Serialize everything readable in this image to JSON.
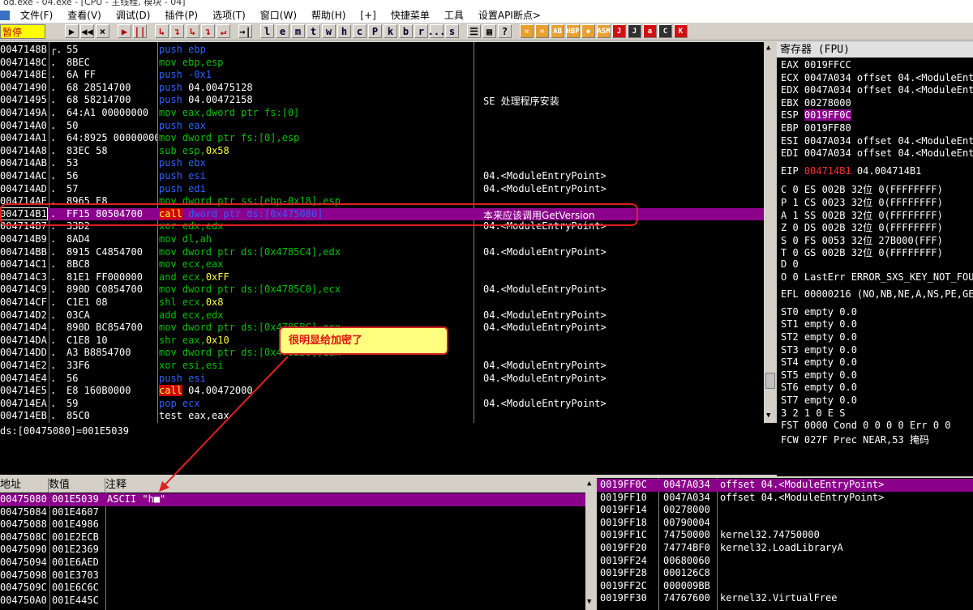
{
  "titlebar": {
    "text": "od.exe - 04.exe - [CPU - 主线程, 模块 - 04]"
  },
  "menu": [
    "文件(F)",
    "查看(V)",
    "调试(D)",
    "插件(P)",
    "选项(T)",
    "窗口(W)",
    "帮助(H)",
    "[+]",
    "快捷菜单",
    "工具",
    "设置API断点>"
  ],
  "status": "暂停",
  "toolbar": {
    "g1": [
      "▶",
      "◀◀",
      "×"
    ],
    "g2": [
      "▶",
      "||"
    ],
    "g3": [
      "↳",
      "↴",
      "↳",
      "↴",
      "↵"
    ],
    "g4": [
      "→|"
    ],
    "letters": [
      "l",
      "e",
      "m",
      "t",
      "w",
      "h",
      "c",
      "P",
      "k",
      "b",
      "r",
      "...",
      "s"
    ],
    "g5": [
      "☰",
      "▦",
      "?"
    ],
    "g6": [
      "⚒",
      "⚒",
      "AB",
      "HBP",
      "◆",
      "ASM",
      "J",
      "J",
      "a",
      "C",
      "K"
    ]
  },
  "disasm": [
    {
      "addr": "0047148B",
      "bra": "┌.",
      "hex": "55",
      "dis": [
        [
          "b",
          "push "
        ],
        [
          "b",
          "ebp"
        ]
      ],
      "cmt": ""
    },
    {
      "addr": "0047148C",
      "bra": ".",
      "hex": "8BEC",
      "dis": [
        [
          "g",
          "mov "
        ],
        [
          "g",
          "ebp,esp"
        ]
      ],
      "cmt": ""
    },
    {
      "addr": "0047148E",
      "bra": ".",
      "hex": "6A FF",
      "dis": [
        [
          "b",
          "push "
        ],
        [
          "b",
          "-0x1"
        ]
      ],
      "cmt": ""
    },
    {
      "addr": "00471490",
      "bra": ".",
      "hex": "68 28514700",
      "dis": [
        [
          "b",
          "push "
        ],
        [
          "w",
          "04.00475128"
        ]
      ],
      "cmt": ""
    },
    {
      "addr": "00471495",
      "bra": ".",
      "hex": "68 58214700",
      "dis": [
        [
          "b",
          "push "
        ],
        [
          "w",
          "04.00472158"
        ]
      ],
      "cmt": "SE 处理程序安装"
    },
    {
      "addr": "0047149A",
      "bra": ".",
      "hex": "64:A1 00000000",
      "dis": [
        [
          "g",
          "mov "
        ],
        [
          "g",
          "eax,dword ptr fs:[0]"
        ]
      ],
      "cmt": ""
    },
    {
      "addr": "004714A0",
      "bra": ".",
      "hex": "50",
      "dis": [
        [
          "b",
          "push "
        ],
        [
          "b",
          "eax"
        ]
      ],
      "cmt": ""
    },
    {
      "addr": "004714A1",
      "bra": ".",
      "hex": "64:8925 00000000",
      "dis": [
        [
          "g",
          "mov "
        ],
        [
          "g",
          "dword ptr fs:[0],esp"
        ]
      ],
      "cmt": ""
    },
    {
      "addr": "004714A8",
      "bra": ".",
      "hex": "83EC 58",
      "dis": [
        [
          "g",
          "sub "
        ],
        [
          "g",
          "esp,"
        ],
        [
          "y",
          "0x58"
        ]
      ],
      "cmt": ""
    },
    {
      "addr": "004714AB",
      "bra": ".",
      "hex": "53",
      "dis": [
        [
          "b",
          "push "
        ],
        [
          "b",
          "ebx"
        ]
      ],
      "cmt": ""
    },
    {
      "addr": "004714AC",
      "bra": ".",
      "hex": "56",
      "dis": [
        [
          "b",
          "push "
        ],
        [
          "b",
          "esi"
        ]
      ],
      "cmt": "04.<ModuleEntryPoint>"
    },
    {
      "addr": "004714AD",
      "bra": ".",
      "hex": "57",
      "dis": [
        [
          "b",
          "push "
        ],
        [
          "b",
          "edi"
        ]
      ],
      "cmt": "04.<ModuleEntryPoint>"
    },
    {
      "addr": "004714AE",
      "bra": ".",
      "hex": "8965 E8",
      "dis": [
        [
          "g",
          "mov "
        ],
        [
          "g",
          "dword ptr ss:[ebp-0x18],esp"
        ]
      ],
      "cmt": ""
    },
    {
      "addr": "004714B1",
      "bra": ".",
      "hex": "FF15 80504700",
      "dis": [
        [
          "call",
          "call"
        ],
        [
          "b",
          " dword ptr ds:[0x475080]"
        ]
      ],
      "cmt": "本来应该调用GetVersion",
      "sel": true
    },
    {
      "addr": "004714B7",
      "bra": ".",
      "hex": "33D2",
      "dis": [
        [
          "g",
          "xor "
        ],
        [
          "g",
          "edx,edx"
        ]
      ],
      "cmt": "04.<ModuleEntryPoint>"
    },
    {
      "addr": "004714B9",
      "bra": ".",
      "hex": "8AD4",
      "dis": [
        [
          "g",
          "mov "
        ],
        [
          "g",
          "dl,ah"
        ]
      ],
      "cmt": ""
    },
    {
      "addr": "004714BB",
      "bra": ".",
      "hex": "8915 C4854700",
      "dis": [
        [
          "g",
          "mov "
        ],
        [
          "g",
          "dword ptr ds:[0x4785C4],edx"
        ]
      ],
      "cmt": "04.<ModuleEntryPoint>"
    },
    {
      "addr": "004714C1",
      "bra": ".",
      "hex": "8BC8",
      "dis": [
        [
          "g",
          "mov "
        ],
        [
          "g",
          "ecx,eax"
        ]
      ],
      "cmt": ""
    },
    {
      "addr": "004714C3",
      "bra": ".",
      "hex": "81E1 FF000000",
      "dis": [
        [
          "g",
          "and "
        ],
        [
          "g",
          "ecx,"
        ],
        [
          "y",
          "0xFF"
        ]
      ],
      "cmt": ""
    },
    {
      "addr": "004714C9",
      "bra": ".",
      "hex": "890D C0854700",
      "dis": [
        [
          "g",
          "mov "
        ],
        [
          "g",
          "dword ptr ds:[0x4785C0],ecx"
        ]
      ],
      "cmt": "04.<ModuleEntryPoint>"
    },
    {
      "addr": "004714CF",
      "bra": ".",
      "hex": "C1E1 08",
      "dis": [
        [
          "g",
          "shl "
        ],
        [
          "g",
          "ecx,"
        ],
        [
          "y",
          "0x8"
        ]
      ],
      "cmt": ""
    },
    {
      "addr": "004714D2",
      "bra": ".",
      "hex": "03CA",
      "dis": [
        [
          "g",
          "add "
        ],
        [
          "g",
          "ecx,edx"
        ]
      ],
      "cmt": "04.<ModuleEntryPoint>"
    },
    {
      "addr": "004714D4",
      "bra": ".",
      "hex": "890D BC854700",
      "dis": [
        [
          "g",
          "mov "
        ],
        [
          "g",
          "dword ptr ds:[0x4785BC],ecx"
        ]
      ],
      "cmt": "04.<ModuleEntryPoint>"
    },
    {
      "addr": "004714DA",
      "bra": ".",
      "hex": "C1E8 10",
      "dis": [
        [
          "g",
          "shr "
        ],
        [
          "g",
          "eax,"
        ],
        [
          "y",
          "0x10"
        ]
      ],
      "cmt": ""
    },
    {
      "addr": "004714DD",
      "bra": ".",
      "hex": "A3 B8854700",
      "dis": [
        [
          "g",
          "mov "
        ],
        [
          "g",
          "dword ptr ds:[0x4785B8],eax"
        ]
      ],
      "cmt": ""
    },
    {
      "addr": "004714E2",
      "bra": ".",
      "hex": "33F6",
      "dis": [
        [
          "g",
          "xor "
        ],
        [
          "g",
          "esi,esi"
        ]
      ],
      "cmt": "04.<ModuleEntryPoint>"
    },
    {
      "addr": "004714E4",
      "bra": ".",
      "hex": "56",
      "dis": [
        [
          "b",
          "push "
        ],
        [
          "b",
          "esi"
        ]
      ],
      "cmt": "04.<ModuleEntryPoint>"
    },
    {
      "addr": "004714E5",
      "bra": ".",
      "hex": "E8 160B0000",
      "dis": [
        [
          "call",
          "call"
        ],
        [
          "w",
          " 04.00472000"
        ]
      ],
      "cmt": ""
    },
    {
      "addr": "004714EA",
      "bra": ".",
      "hex": "59",
      "dis": [
        [
          "b",
          "pop "
        ],
        [
          "b",
          "ecx"
        ]
      ],
      "cmt": "04.<ModuleEntryPoint>"
    },
    {
      "addr": "004714EB",
      "bra": ".",
      "hex": "85C0",
      "dis": [
        [
          "w",
          "test "
        ],
        [
          "w",
          "eax,eax"
        ]
      ],
      "cmt": ""
    }
  ],
  "info_line": "ds:[00475080]=001E5039",
  "registers": {
    "title": "寄存器 (FPU)",
    "lines": [
      [
        "EAX 0019FFCC",
        ""
      ],
      [
        "ECX 0047A034 offset 04.<ModuleEntryPoint>",
        ""
      ],
      [
        "EDX 0047A034 offset 04.<ModuleEntryPoint>",
        ""
      ],
      [
        "EBX 00278000",
        ""
      ],
      [
        "ESP ",
        "0019FF0C"
      ],
      [
        "EBP 0019FF80",
        ""
      ],
      [
        "ESI 0047A034 offset 04.<ModuleEntryPoint>",
        ""
      ],
      [
        "EDI 0047A034 offset 04.<ModuleEntryPoint>",
        ""
      ]
    ],
    "eip_label": "EIP ",
    "eip_val": "004714B1",
    "eip_rest": " 04.004714B1",
    "flags": [
      "C 0  ES 002B 32位 0(FFFFFFFF)",
      "P 1  CS 0023 32位 0(FFFFFFFF)",
      "A 1  SS 002B 32位 0(FFFFFFFF)",
      "Z 0  DS 002B 32位 0(FFFFFFFF)",
      "S 0  FS 0053 32位 27B000(FFF)",
      "T 0  GS 002B 32位 0(FFFFFFFF)",
      "D 0",
      "O 0  LastErr ERROR_SXS_KEY_NOT_FOUND"
    ],
    "efl": "EFL 00000216 (NO,NB,NE,A,NS,PE,GE,G)",
    "st": [
      "ST0 empty 0.0",
      "ST1 empty 0.0",
      "ST2 empty 0.0",
      "ST3 empty 0.0",
      "ST4 empty 0.0",
      "ST5 empty 0.0",
      "ST6 empty 0.0",
      "ST7 empty 0.0"
    ],
    "fpu_hdr": "               3 2 1 0      E S",
    "fst": "FST 0000  Cond 0 0 0 0  Err 0 0",
    "fcw": "FCW 027F  Prec NEAR,53  掩码"
  },
  "dump": {
    "headers": [
      "地址",
      "数值",
      "注释"
    ],
    "rows": [
      [
        "00475080",
        "001E5039",
        "ASCII \"h■\""
      ],
      [
        "00475084",
        "001E4607",
        ""
      ],
      [
        "00475088",
        "001E4986",
        ""
      ],
      [
        "0047508C",
        "001E2ECB",
        ""
      ],
      [
        "00475090",
        "001E2369",
        ""
      ],
      [
        "00475094",
        "001E6AED",
        ""
      ],
      [
        "00475098",
        "001E3703",
        ""
      ],
      [
        "0047509C",
        "001E6C6C",
        ""
      ],
      [
        "004750A0",
        "001E445C",
        ""
      ]
    ]
  },
  "stack": [
    [
      "0019FF0C",
      "0047A034",
      "offset 04.<ModuleEntryPoint>"
    ],
    [
      "0019FF10",
      "0047A034",
      "offset 04.<ModuleEntryPoint>"
    ],
    [
      "0019FF14",
      "00278000",
      ""
    ],
    [
      "0019FF18",
      "00790004",
      ""
    ],
    [
      "0019FF1C",
      "74750000",
      "kernel32.74750000"
    ],
    [
      "0019FF20",
      "74774BF0",
      "kernel32.LoadLibraryA"
    ],
    [
      "0019FF24",
      "00680060",
      ""
    ],
    [
      "0019FF28",
      "000126C8",
      ""
    ],
    [
      "0019FF2C",
      "000009BB",
      ""
    ],
    [
      "0019FF30",
      "74767600",
      "kernel32.VirtualFree"
    ]
  ],
  "annotation": {
    "text": "很明显给加密了"
  },
  "colors": {
    "selection": "#8b008b",
    "callbg": "#d00000",
    "annotation_border": "#d02020"
  }
}
